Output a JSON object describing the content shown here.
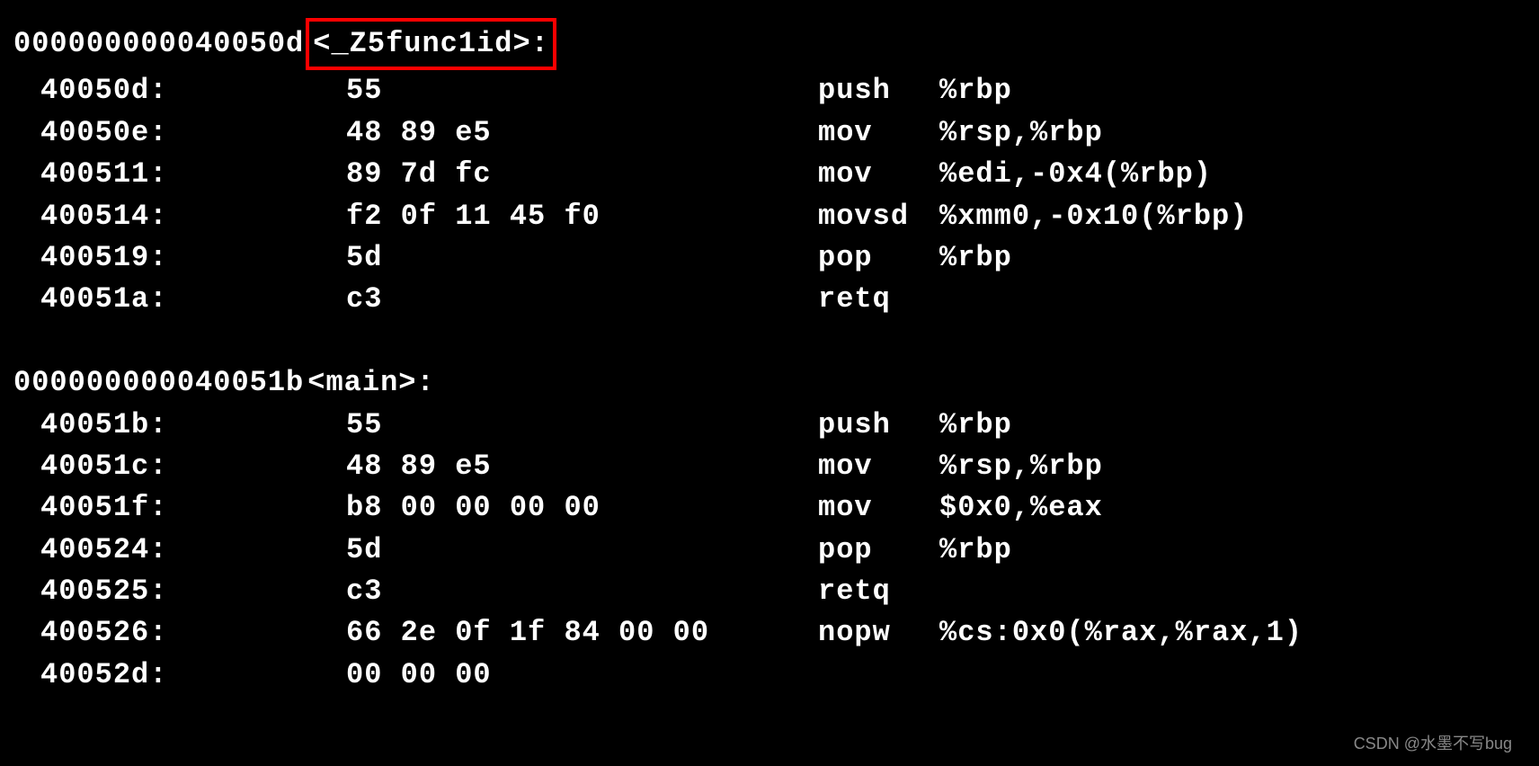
{
  "sections": [
    {
      "header_address": "000000000040050d",
      "header_symbol": "<_Z5func1id>:",
      "highlighted": true,
      "lines": [
        {
          "offset": "40050d:",
          "hex": "55",
          "mnemonic": "push",
          "operands": "%rbp"
        },
        {
          "offset": "40050e:",
          "hex": "48 89 e5",
          "mnemonic": "mov",
          "operands": "%rsp,%rbp"
        },
        {
          "offset": "400511:",
          "hex": "89 7d fc",
          "mnemonic": "mov",
          "operands": "%edi,-0x4(%rbp)"
        },
        {
          "offset": "400514:",
          "hex": "f2 0f 11 45 f0",
          "mnemonic": "movsd",
          "operands": "%xmm0,-0x10(%rbp)"
        },
        {
          "offset": "400519:",
          "hex": "5d",
          "mnemonic": "pop",
          "operands": "%rbp"
        },
        {
          "offset": "40051a:",
          "hex": "c3",
          "mnemonic": "retq",
          "operands": ""
        }
      ]
    },
    {
      "header_address": "000000000040051b",
      "header_symbol": "<main>:",
      "highlighted": false,
      "lines": [
        {
          "offset": "40051b:",
          "hex": "55",
          "mnemonic": "push",
          "operands": "%rbp"
        },
        {
          "offset": "40051c:",
          "hex": "48 89 e5",
          "mnemonic": "mov",
          "operands": "%rsp,%rbp"
        },
        {
          "offset": "40051f:",
          "hex": "b8 00 00 00 00",
          "mnemonic": "mov",
          "operands": "$0x0,%eax"
        },
        {
          "offset": "400524:",
          "hex": "5d",
          "mnemonic": "pop",
          "operands": "%rbp"
        },
        {
          "offset": "400525:",
          "hex": "c3",
          "mnemonic": "retq",
          "operands": ""
        },
        {
          "offset": "400526:",
          "hex": "66 2e 0f 1f 84 00 00",
          "mnemonic": "nopw",
          "operands": "%cs:0x0(%rax,%rax,1)"
        },
        {
          "offset": "40052d:",
          "hex": "00 00 00",
          "mnemonic": "",
          "operands": ""
        }
      ]
    }
  ],
  "watermark": "CSDN @水墨不写bug"
}
